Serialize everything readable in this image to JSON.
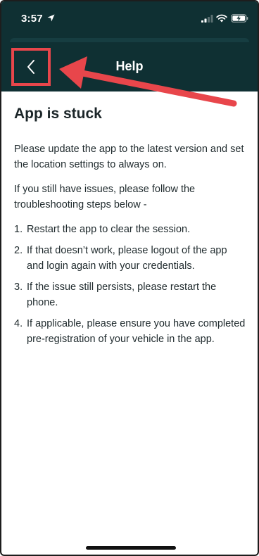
{
  "status_bar": {
    "time": "3:57"
  },
  "header": {
    "title": "Help"
  },
  "content": {
    "title": "App is stuck",
    "intro": "Please update the app to the latest version and set the location settings to always on.",
    "issues_text": "If you still have issues, please follow the troubleshooting steps below -",
    "steps": [
      {
        "num": "1.",
        "text": "Restart the app to clear the session."
      },
      {
        "num": "2.",
        "text": "If that doesn’t work, please logout of the app and login again with your credentials."
      },
      {
        "num": "3.",
        "text": "If the issue still persists, please restart the phone."
      },
      {
        "num": "4.",
        "text": "If applicable, please ensure you have completed pre-registration of your vehicle in the app."
      }
    ]
  },
  "colors": {
    "header_bg": "#0f3033",
    "highlight": "#e8464b",
    "text": "#1f2a2d"
  }
}
